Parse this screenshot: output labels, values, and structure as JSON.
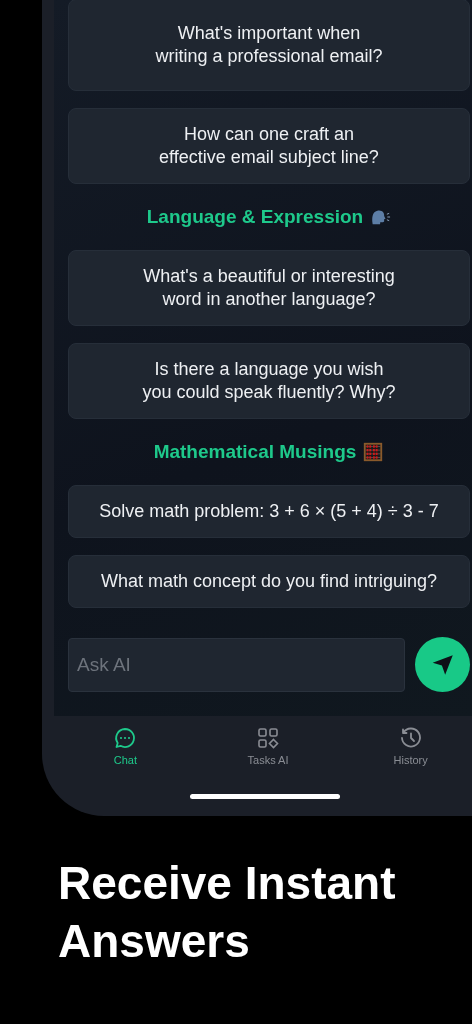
{
  "feed": [
    {
      "kind": "question",
      "text": "What's important when writing a professional email?"
    },
    {
      "kind": "question",
      "text": "How can one craft an effective email subject line?"
    },
    {
      "kind": "heading",
      "text": "Language & Expression"
    },
    {
      "kind": "question",
      "text": "What's a beautiful or interesting word in another language?"
    },
    {
      "kind": "question",
      "text": "Is there a language you wish you could speak fluently? Why?"
    },
    {
      "kind": "heading",
      "text": "Mathematical Musings"
    },
    {
      "kind": "question",
      "text": "Solve math problem: 3 + 6 × (5 + 4) ÷ 3 - 7"
    },
    {
      "kind": "question",
      "text": "What math concept do you find intriguing?"
    }
  ],
  "input": {
    "placeholder": "Ask AI"
  },
  "tabs": [
    {
      "label": "Chat",
      "selected": true
    },
    {
      "label": "Tasks AI",
      "selected": false
    },
    {
      "label": "History",
      "selected": false
    }
  ],
  "caption": "Receive Instant Answers"
}
